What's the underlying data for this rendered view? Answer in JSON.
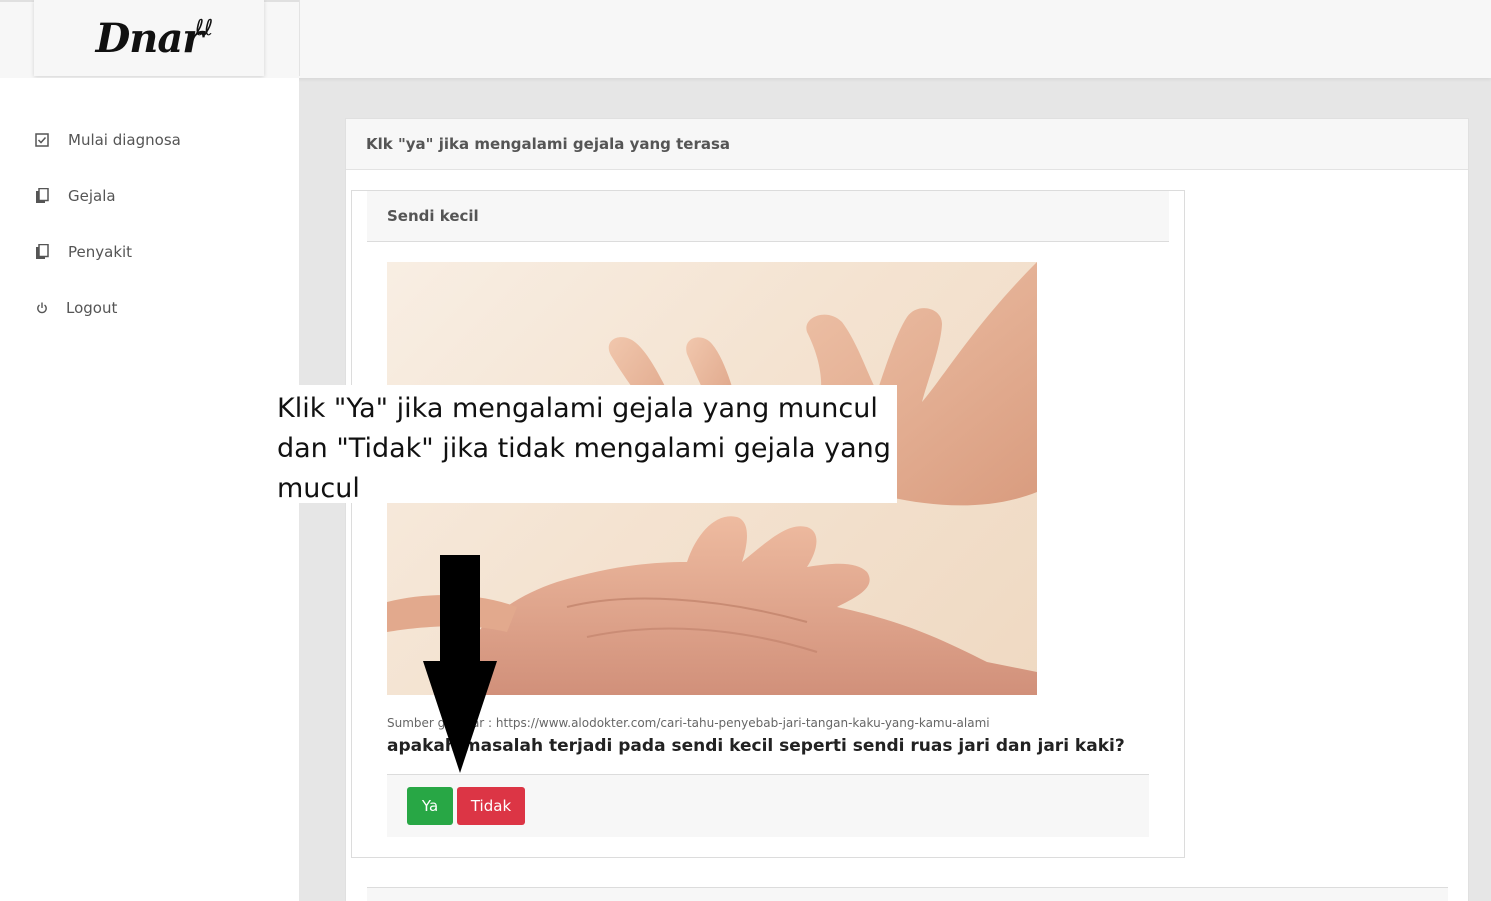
{
  "app": {
    "logo_text": "Dnar",
    "logo_mark": "ℓℓ"
  },
  "sidebar": {
    "items": [
      {
        "label": "Mulai diagnosa",
        "icon": "checkbox-icon"
      },
      {
        "label": "Gejala",
        "icon": "document-icon"
      },
      {
        "label": "Penyakit",
        "icon": "document-icon"
      },
      {
        "label": "Logout",
        "icon": "power-icon"
      }
    ]
  },
  "main": {
    "card_title": "Klk \"ya\" jika mengalami gejala yang terasa",
    "symptom": {
      "title": "Sendi kecil",
      "image_source": "Sumber gambar : https://www.alodokter.com/cari-tahu-penyebab-jari-tangan-kaku-yang-kamu-alami",
      "question": "apakah masalah terjadi pada sendi kecil seperti sendi ruas jari dan jari kaki?",
      "yes_label": "Ya",
      "no_label": "Tidak"
    }
  },
  "annotation": {
    "text": "Klik \"Ya\" jika mengalami gejala yang muncul dan \"Tidak\" jika tidak mengalami gejala yang mucul"
  },
  "colors": {
    "yes": "#28a745",
    "no": "#dc3545",
    "header_bg": "#f7f7f7",
    "content_bg": "#e6e6e6"
  }
}
